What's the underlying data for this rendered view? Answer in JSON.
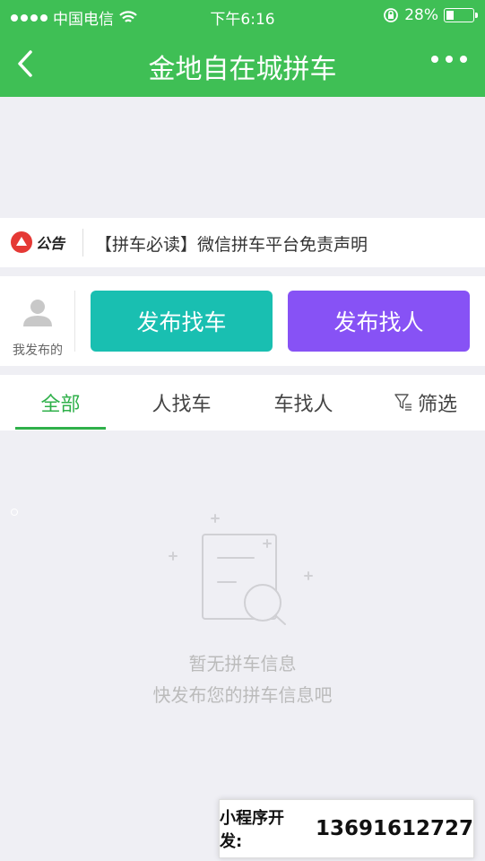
{
  "status_bar": {
    "carrier": "中国电信",
    "time": "下午6:16",
    "battery_percent": "28%",
    "battery_level": 0.28,
    "signal_dots_filled": 4
  },
  "nav": {
    "title": "金地自在城拼车"
  },
  "notice": {
    "badge_text": "公告",
    "text": "【拼车必读】微信拼车平台免责声明"
  },
  "actions": {
    "mine_label": "我发布的",
    "find_car_label": "发布找车",
    "find_people_label": "发布找人"
  },
  "tabs": {
    "items": [
      {
        "label": "全部",
        "active": true
      },
      {
        "label": "人找车",
        "active": false
      },
      {
        "label": "车找人",
        "active": false
      },
      {
        "label": "筛选",
        "active": false
      }
    ]
  },
  "empty_state": {
    "line1": "暂无拼车信息",
    "line2": "快发布您的拼车信息吧"
  },
  "contact": {
    "label": "小程序开发:",
    "number": "13691612727"
  },
  "colors": {
    "brand_green": "#3fbf55",
    "tab_green": "#2fb04a",
    "teal": "#19bfb1",
    "purple": "#8752f5"
  }
}
